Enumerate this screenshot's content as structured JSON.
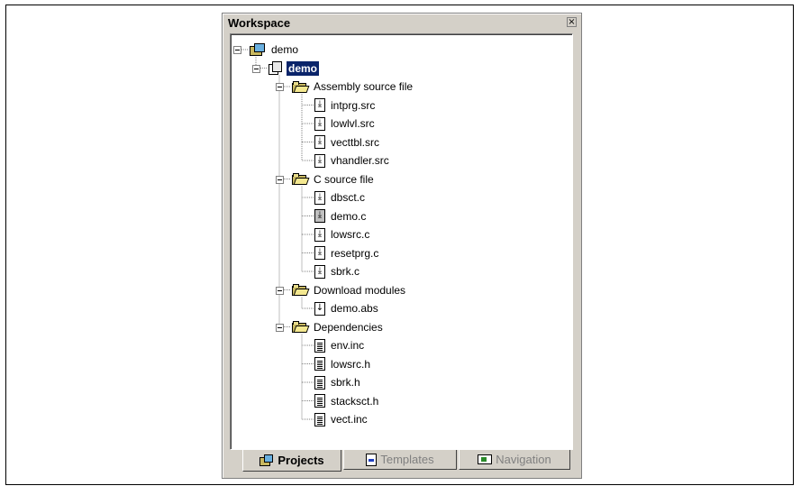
{
  "window": {
    "title": "Workspace",
    "close_glyph": "×"
  },
  "tree": [
    {
      "id": "workspace",
      "label": "demo",
      "type": "workspace",
      "depth": 0,
      "expanded": true
    },
    {
      "id": "project",
      "label": "demo",
      "type": "project",
      "depth": 1,
      "expanded": true,
      "selected": true
    },
    {
      "id": "folder-assembly",
      "label": "Assembly source file",
      "type": "folder",
      "depth": 2,
      "expanded": true
    },
    {
      "id": "intprg",
      "label": "intprg.src",
      "type": "source",
      "depth": 3
    },
    {
      "id": "lowlvl",
      "label": "lowlvl.src",
      "type": "source",
      "depth": 3
    },
    {
      "id": "vecttbl",
      "label": "vecttbl.src",
      "type": "source",
      "depth": 3
    },
    {
      "id": "vhandler",
      "label": "vhandler.src",
      "type": "source",
      "depth": 3
    },
    {
      "id": "folder-c",
      "label": "C source file",
      "type": "folder",
      "depth": 2,
      "expanded": true
    },
    {
      "id": "dbsct",
      "label": "dbsct.c",
      "type": "source",
      "depth": 3
    },
    {
      "id": "democ",
      "label": "demo.c",
      "type": "source-open",
      "depth": 3
    },
    {
      "id": "lowsrc-c",
      "label": "lowsrc.c",
      "type": "source",
      "depth": 3
    },
    {
      "id": "resetprg",
      "label": "resetprg.c",
      "type": "source",
      "depth": 3
    },
    {
      "id": "sbrk-c",
      "label": "sbrk.c",
      "type": "source",
      "depth": 3
    },
    {
      "id": "folder-download",
      "label": "Download modules",
      "type": "folder",
      "depth": 2,
      "expanded": true
    },
    {
      "id": "demoabs",
      "label": "demo.abs",
      "type": "download",
      "depth": 3
    },
    {
      "id": "folder-deps",
      "label": "Dependencies",
      "type": "folder",
      "depth": 2,
      "expanded": true
    },
    {
      "id": "envinc",
      "label": "env.inc",
      "type": "header",
      "depth": 3
    },
    {
      "id": "lowsrc-h",
      "label": "lowsrc.h",
      "type": "header",
      "depth": 3
    },
    {
      "id": "sbrk-h",
      "label": "sbrk.h",
      "type": "header",
      "depth": 3
    },
    {
      "id": "stacksct",
      "label": "stacksct.h",
      "type": "header",
      "depth": 3
    },
    {
      "id": "vectinc",
      "label": "vect.inc",
      "type": "header",
      "depth": 3
    }
  ],
  "tabs": [
    {
      "label": "Projects",
      "icon": "workspace-icon",
      "active": true
    },
    {
      "label": "Templates",
      "icon": "template-icon",
      "active": false
    },
    {
      "label": "Navigation",
      "icon": "navigation-icon",
      "active": false
    }
  ],
  "colors": {
    "selection": "#0a246a",
    "window_face": "#d4d0c8"
  }
}
